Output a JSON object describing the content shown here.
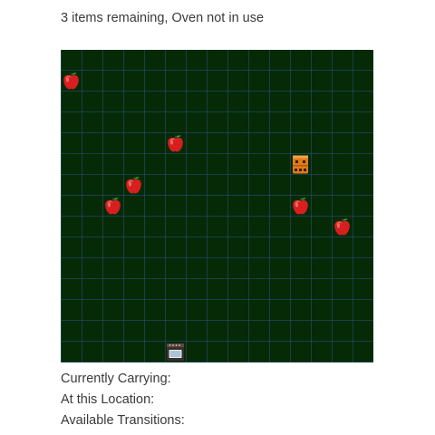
{
  "status": {
    "text": "3 items remaining, Oven not in use"
  },
  "board": {
    "columns": 15,
    "rows": 15,
    "background": "#062a06",
    "grid_color": "#28508a",
    "items": [
      {
        "type": "apple",
        "icon": "apple-icon",
        "col": 0,
        "row": 1
      },
      {
        "type": "apple",
        "icon": "apple-icon",
        "col": 5,
        "row": 4
      },
      {
        "type": "apple",
        "icon": "apple-icon",
        "col": 3,
        "row": 6
      },
      {
        "type": "apple",
        "icon": "apple-icon",
        "col": 2,
        "row": 7
      },
      {
        "type": "apple",
        "icon": "apple-icon",
        "col": 11,
        "row": 7
      },
      {
        "type": "apple",
        "icon": "apple-icon",
        "col": 13,
        "row": 8
      },
      {
        "type": "agent",
        "icon": "robot-agent-icon",
        "col": 11,
        "row": 5
      },
      {
        "type": "oven",
        "icon": "oven-icon",
        "col": 5,
        "row": 14
      }
    ]
  },
  "info": {
    "carrying_label": "Currently Carrying:",
    "carrying_value": "",
    "location_label": "At this Location:",
    "location_value": "",
    "transitions_label": "Available Transitions:",
    "transitions_value": ""
  }
}
